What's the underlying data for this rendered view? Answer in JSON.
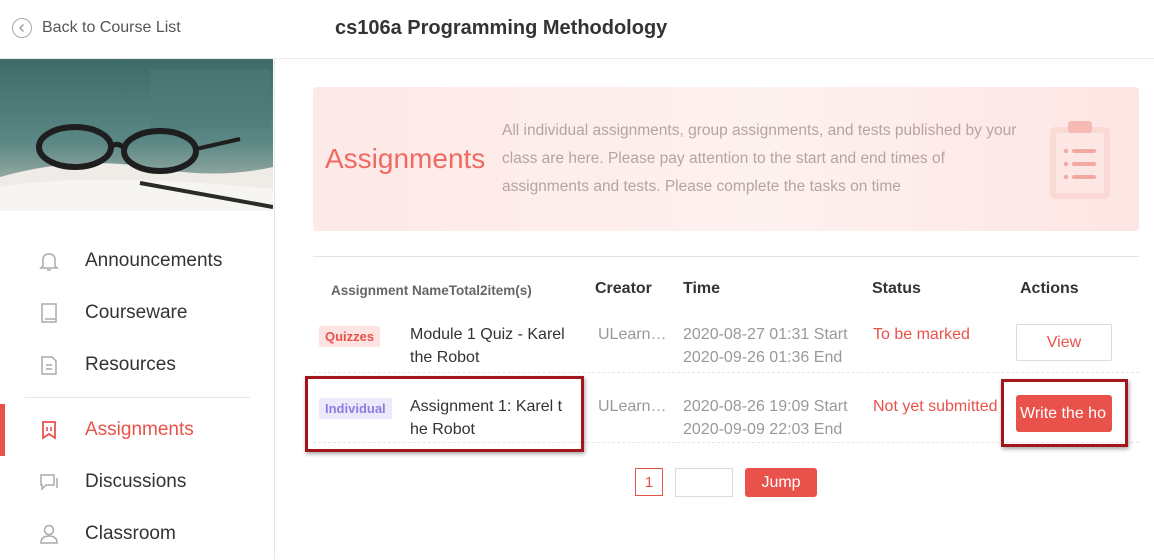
{
  "header": {
    "back_label": "Back to Course List",
    "course_title": "cs106a Programming Methodology"
  },
  "sidebar": {
    "items": [
      {
        "label": "Announcements",
        "icon": "bell-icon"
      },
      {
        "label": "Courseware",
        "icon": "book-icon"
      },
      {
        "label": "Resources",
        "icon": "folder-icon"
      },
      {
        "label": "Assignments",
        "icon": "bookmark-icon",
        "active": true
      },
      {
        "label": "Discussions",
        "icon": "chat-icon"
      },
      {
        "label": "Classroom",
        "icon": "person-icon"
      }
    ]
  },
  "intro": {
    "title": "Assignments",
    "description": "All individual assignments, group assignments, and tests published by your class are here. Please pay attention to the start and end times of assignments and tests. Please complete the tasks on time"
  },
  "table": {
    "headers": {
      "name": "Assignment NameTotal2item(s)",
      "creator": "Creator",
      "time": "Time",
      "status": "Status",
      "actions": "Actions"
    },
    "rows": [
      {
        "tag": "Quizzes",
        "name": "Module 1 Quiz - Karel the Robot",
        "creator": "ULearn…",
        "start": "2020-08-27 01:31 Start",
        "end": "2020-09-26 01:36 End",
        "status": "To be marked",
        "action": "View"
      },
      {
        "tag": "Individual",
        "name": "Assignment 1: Karel the Robot",
        "name_line1": "Assignment 1: Karel t",
        "name_line2": "he Robot",
        "creator": "ULearn…",
        "start": "2020-08-26 19:09 Start",
        "end": "2020-09-09 22:03 End",
        "status": "Not yet submitted",
        "action": "Write the ho"
      }
    ]
  },
  "pagination": {
    "current_page": "1",
    "jump_label": "Jump"
  },
  "colors": {
    "accent": "#e8524a",
    "highlight_box": "#a4141b"
  }
}
